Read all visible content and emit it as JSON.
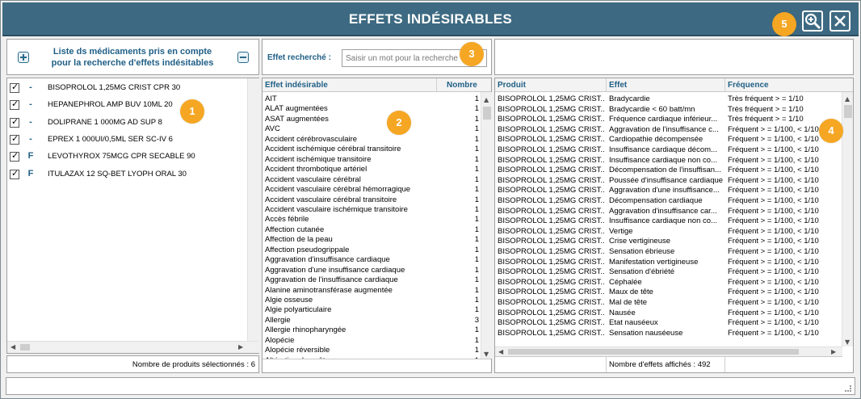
{
  "window": {
    "title": "EFFETS INDÉSIRABLES"
  },
  "badges": [
    "1",
    "2",
    "3",
    "4",
    "5"
  ],
  "medications": {
    "header_title": "Liste ds médicaments pris en compte pour la recherche d'effets indésitables",
    "items": [
      {
        "type": "-",
        "name": "BISOPROLOL 1,25MG CRIST CPR 30"
      },
      {
        "type": "-",
        "name": "HEPANEPHROL AMP BUV 10ML 20"
      },
      {
        "type": "-",
        "name": "DOLIPRANE 1 000MG AD SUP 8"
      },
      {
        "type": "-",
        "name": "EPREX 1 000UI/0,5ML SER SC-IV 6"
      },
      {
        "type": "F",
        "name": "LEVOTHYROX 75MCG CPR SECABLE 90"
      },
      {
        "type": "F",
        "name": "ITULAZAX 12 SQ-BET LYOPH ORAL 30"
      }
    ],
    "count_text": "Nombre de produits sélectionnés : 6"
  },
  "search": {
    "label": "Effet recherché :",
    "placeholder": "Saisir un mot pour la recherche"
  },
  "effects": {
    "col_effect": "Effet indésirable",
    "col_count": "Nombre",
    "rows": [
      [
        "AIT",
        "1"
      ],
      [
        "ALAT augmentées",
        "1"
      ],
      [
        "ASAT augmentées",
        "1"
      ],
      [
        "AVC",
        "1"
      ],
      [
        "Accident cérébrovasculaire",
        "1"
      ],
      [
        "Accident ischémique cérébral transitoire",
        "1"
      ],
      [
        "Accident ischémique transitoire",
        "1"
      ],
      [
        "Accident thrombotique artériel",
        "1"
      ],
      [
        "Accident vasculaire cérébral",
        "1"
      ],
      [
        "Accident vasculaire cérébral hémorragique",
        "1"
      ],
      [
        "Accident vasculaire cérébral transitoire",
        "1"
      ],
      [
        "Accident vasculaire ischémique transitoire",
        "1"
      ],
      [
        "Accès fébrile",
        "1"
      ],
      [
        "Affection cutanée",
        "1"
      ],
      [
        "Affection de la peau",
        "1"
      ],
      [
        "Affection pseudogrippale",
        "1"
      ],
      [
        "Aggravation d'insuffisance cardiaque",
        "1"
      ],
      [
        "Aggravation d'une insuffisance cardiaque",
        "1"
      ],
      [
        "Aggravation de l'insuffisance cardiaque",
        "1"
      ],
      [
        "Alanine aminotransférase augmentée",
        "1"
      ],
      [
        "Algie osseuse",
        "1"
      ],
      [
        "Algie polyarticulaire",
        "1"
      ],
      [
        "Allergie",
        "3"
      ],
      [
        "Allergie rhinopharyngée",
        "1"
      ],
      [
        "Alopécie",
        "1"
      ],
      [
        "Alopécie réversible",
        "1"
      ],
      [
        "Altération du goût",
        "1"
      ]
    ]
  },
  "results": {
    "col_product": "Produit",
    "col_effect": "Effet",
    "col_frequency": "Fréquence",
    "rows": [
      [
        "BISOPROLOL 1,25MG CRIST...",
        "Bradycardie",
        "Très fréquent > = 1/10"
      ],
      [
        "BISOPROLOL 1,25MG CRIST...",
        "Bradycardie < 60 batt/mn",
        "Très fréquent > = 1/10"
      ],
      [
        "BISOPROLOL 1,25MG CRIST...",
        "Fréquence cardiaque inférieur...",
        "Très fréquent > = 1/10"
      ],
      [
        "BISOPROLOL 1,25MG CRIST...",
        "Aggravation de l'insuffisance c...",
        "Fréquent > = 1/100, < 1/10"
      ],
      [
        "BISOPROLOL 1,25MG CRIST...",
        "Cardiopathie décompensée",
        "Fréquent > = 1/100, < 1/10"
      ],
      [
        "BISOPROLOL 1,25MG CRIST...",
        "Insuffisance cardiaque décom...",
        "Fréquent > = 1/100, < 1/10"
      ],
      [
        "BISOPROLOL 1,25MG CRIST...",
        "Insuffisance cardiaque non co...",
        "Fréquent > = 1/100, < 1/10"
      ],
      [
        "BISOPROLOL 1,25MG CRIST...",
        "Décompensation de l'insuffisan...",
        "Fréquent > = 1/100, < 1/10"
      ],
      [
        "BISOPROLOL 1,25MG CRIST...",
        "Poussée d'insuffisance cardiaque",
        "Fréquent > = 1/100, < 1/10"
      ],
      [
        "BISOPROLOL 1,25MG CRIST...",
        "Aggravation d'une insuffisance...",
        "Fréquent > = 1/100, < 1/10"
      ],
      [
        "BISOPROLOL 1,25MG CRIST...",
        "Décompensation cardiaque",
        "Fréquent > = 1/100, < 1/10"
      ],
      [
        "BISOPROLOL 1,25MG CRIST...",
        "Aggravation d'insuffisance car...",
        "Fréquent > = 1/100, < 1/10"
      ],
      [
        "BISOPROLOL 1,25MG CRIST...",
        "Insuffisance cardiaque non co...",
        "Fréquent > = 1/100, < 1/10"
      ],
      [
        "BISOPROLOL 1,25MG CRIST...",
        "Vertige",
        "Fréquent > = 1/100, < 1/10"
      ],
      [
        "BISOPROLOL 1,25MG CRIST...",
        "Crise vertigineuse",
        "Fréquent > = 1/100, < 1/10"
      ],
      [
        "BISOPROLOL 1,25MG CRIST...",
        "Sensation ébrieuse",
        "Fréquent > = 1/100, < 1/10"
      ],
      [
        "BISOPROLOL 1,25MG CRIST...",
        "Manifestation vertigineuse",
        "Fréquent > = 1/100, < 1/10"
      ],
      [
        "BISOPROLOL 1,25MG CRIST...",
        "Sensation d'ébriété",
        "Fréquent > = 1/100, < 1/10"
      ],
      [
        "BISOPROLOL 1,25MG CRIST...",
        "Céphalée",
        "Fréquent > = 1/100, < 1/10"
      ],
      [
        "BISOPROLOL 1,25MG CRIST...",
        "Maux de tête",
        "Fréquent > = 1/100, < 1/10"
      ],
      [
        "BISOPROLOL 1,25MG CRIST...",
        "Mal de tête",
        "Fréquent > = 1/100, < 1/10"
      ],
      [
        "BISOPROLOL 1,25MG CRIST...",
        "Nausée",
        "Fréquent > = 1/100, < 1/10"
      ],
      [
        "BISOPROLOL 1,25MG CRIST...",
        "Etat nauséeux",
        "Fréquent > = 1/100, < 1/10"
      ],
      [
        "BISOPROLOL 1,25MG CRIST...",
        "Sensation nauséeuse",
        "Fréquent > = 1/100, < 1/10"
      ]
    ],
    "count_text": "Nombre d'effets affichés : 492"
  }
}
